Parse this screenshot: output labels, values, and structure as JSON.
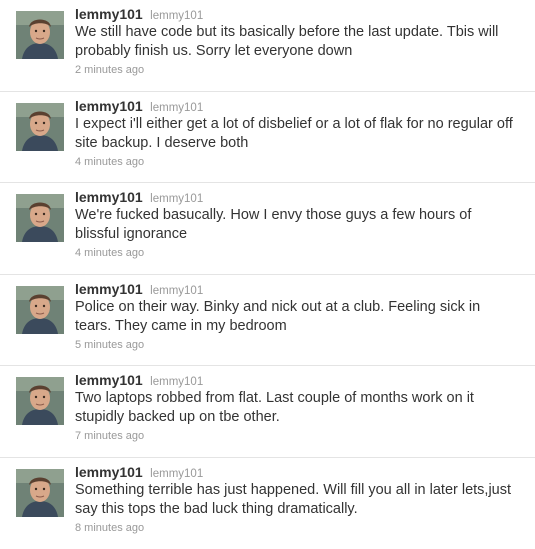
{
  "colors": {
    "text": "#333333",
    "muted": "#999999",
    "divider": "#e4e4e4",
    "background": "#ffffff"
  },
  "tweets": [
    {
      "screen_name": "lemmy101",
      "full_name": "lemmy101",
      "text": "We still have code but its basically before the last update. Tbis will probably finish us. Sorry let everyone down",
      "time": "2 minutes ago",
      "avatar_icon": "user-avatar-icon"
    },
    {
      "screen_name": "lemmy101",
      "full_name": "lemmy101",
      "text": "I expect i'll either get a lot of disbelief or a lot of flak for no regular off site backup. I deserve both",
      "time": "4 minutes ago",
      "avatar_icon": "user-avatar-icon"
    },
    {
      "screen_name": "lemmy101",
      "full_name": "lemmy101",
      "text": "We're fucked basucally. How I envy those guys a few hours of blissful ignorance",
      "time": "4 minutes ago",
      "avatar_icon": "user-avatar-icon"
    },
    {
      "screen_name": "lemmy101",
      "full_name": "lemmy101",
      "text": "Police on their way. Binky and nick out at a club. Feeling sick in tears. They came in my bedroom",
      "time": "5 minutes ago",
      "avatar_icon": "user-avatar-icon"
    },
    {
      "screen_name": "lemmy101",
      "full_name": "lemmy101",
      "text": "Two laptops robbed from flat. Last couple of months work on it stupidly backed up on tbe other.",
      "time": "7 minutes ago",
      "avatar_icon": "user-avatar-icon"
    },
    {
      "screen_name": "lemmy101",
      "full_name": "lemmy101",
      "text": "Something terrible has just happened. Will fill you all in later lets,just say this tops the bad luck thing dramatically.",
      "time": "8 minutes ago",
      "avatar_icon": "user-avatar-icon"
    }
  ]
}
